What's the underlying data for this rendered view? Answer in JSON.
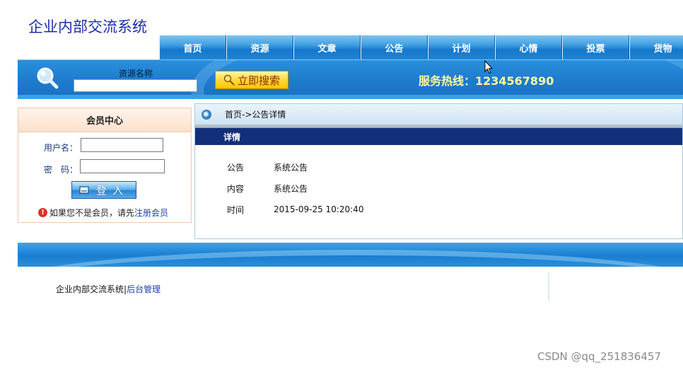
{
  "site": {
    "title": "企业内部交流系统"
  },
  "nav": {
    "items": [
      "首页",
      "资源",
      "文章",
      "公告",
      "计划",
      "心情",
      "投票",
      "货物"
    ]
  },
  "search": {
    "label": "资源名称",
    "value": "",
    "button_label": "立即搜索",
    "hotline": "服务热线：1234567890"
  },
  "member": {
    "title": "会员中心",
    "username_label": "用户名：",
    "password_label": "密　码：",
    "login_label": "登入",
    "register_prefix": "如果您不是会员，请先",
    "register_link": "注册会员"
  },
  "detail": {
    "breadcrumb": "首页->公告详情",
    "heading": "详情",
    "rows": [
      {
        "key": "公告",
        "value": "系统公告"
      },
      {
        "key": "内容",
        "value": "系统公告"
      },
      {
        "key": "时间",
        "value": "2015-09-25 10:20:40"
      }
    ]
  },
  "footer": {
    "system_name": "企业内部交流系统",
    "separator": "|",
    "admin_link": "后台管理"
  },
  "watermark": "CSDN @qq_251836457",
  "colors": {
    "title_blue": "#1a2fa8",
    "nav_blue": "#1678cc",
    "detail_head": "#132f7a",
    "hotline": "#fff7a0"
  }
}
